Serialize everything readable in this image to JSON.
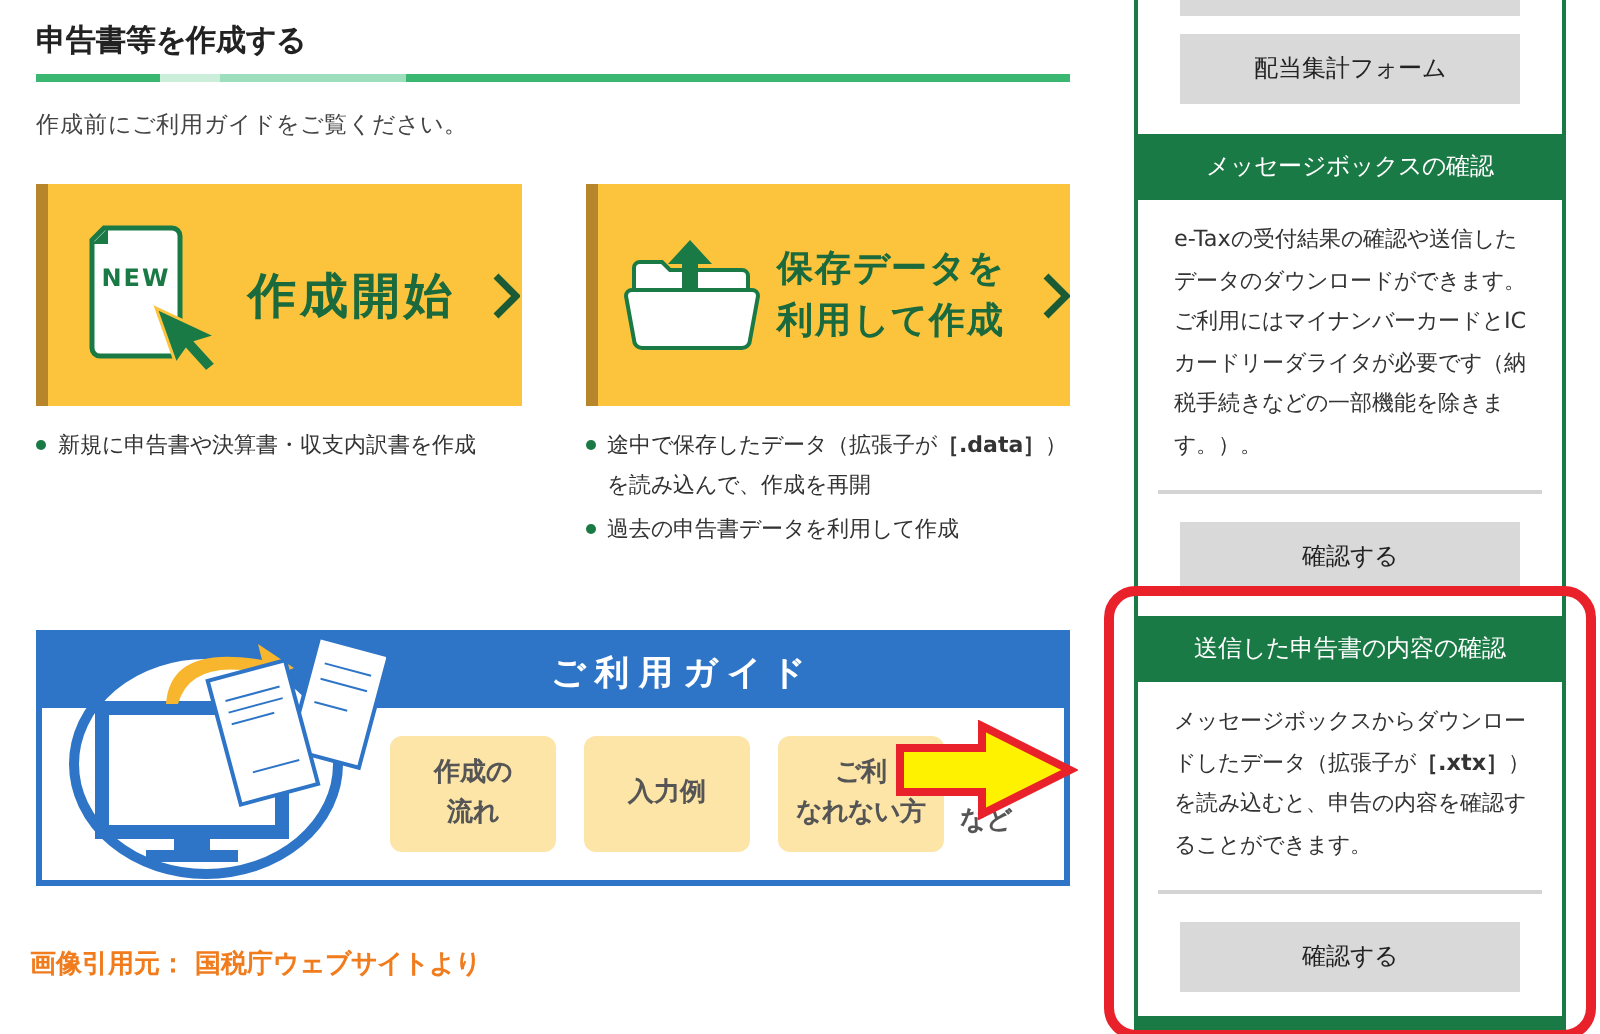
{
  "section": {
    "title": "申告書等を作成する",
    "intro": "作成前にご利用ガイドをご覧ください。"
  },
  "cards": [
    {
      "kind": "new",
      "badge": "NEW",
      "lines": [
        "作成開始"
      ],
      "bullets": [
        "新規に申告書や決算書・収支内訳書を作成"
      ]
    },
    {
      "kind": "saved",
      "lines": [
        "保存データを",
        "利用して作成"
      ],
      "bullets": [
        "途中で保存したデータ（拡張子が**［.data］**）を読み込んで、作成を再開",
        "過去の申告書データを利用して作成"
      ]
    }
  ],
  "guide": {
    "title": "ご利用ガイド",
    "buttons": [
      {
        "lines": [
          "作成の",
          "流れ"
        ]
      },
      {
        "lines": [
          "入力例"
        ]
      },
      {
        "lines": [
          "ご利",
          "なれない方"
        ]
      }
    ],
    "more": "など"
  },
  "sidebar": {
    "top_buttons": [
      "配当集計フォーム"
    ],
    "sections": [
      {
        "title": "メッセージボックスの確認",
        "text": "e-Taxの受付結果の確認や送信したデータのダウンロードができます。ご利用にはマイナンバーカードとICカードリーダライタが必要です（納税手続きなどの一部機能を除きます。）。",
        "button": "確認する",
        "highlighted": false
      },
      {
        "title": "送信した申告書の内容の確認",
        "text": "メッセージボックスからダウンロードしたデータ（拡張子が**［.xtx］**）を読み込むと、申告の内容を確認することができます。",
        "button": "確認する",
        "highlighted": true
      }
    ]
  },
  "credit": "画像引用元： 国税庁ウェブサイトより"
}
